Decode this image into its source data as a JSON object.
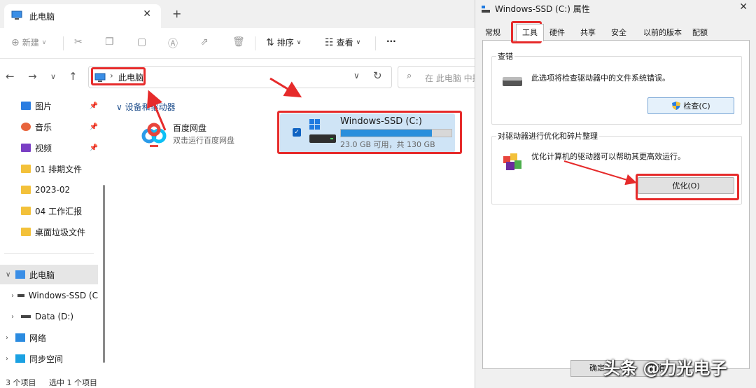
{
  "explorer": {
    "tab_title": "此电脑",
    "tab_close": "✕",
    "new_tab": "+",
    "toolbar": {
      "new_label": "新建",
      "sort_label": "排序",
      "view_label": "查看",
      "more": "···"
    },
    "nav": {
      "back": "←",
      "forward": "→",
      "recent": "∨",
      "up": "↑"
    },
    "address": {
      "crumb": "此电脑",
      "chevron": "›",
      "dropdown": "∨",
      "refresh": "↻"
    },
    "search": {
      "placeholder": "在 此电脑 中搜"
    },
    "sidebar": {
      "pinned": [
        {
          "label": "图片",
          "icon": "picture-icon"
        },
        {
          "label": "音乐",
          "icon": "music-icon"
        },
        {
          "label": "视频",
          "icon": "video-icon"
        },
        {
          "label": "01 排期文件",
          "icon": "folder-icon"
        },
        {
          "label": "2023-02",
          "icon": "folder-icon"
        },
        {
          "label": "04 工作汇报",
          "icon": "folder-icon"
        },
        {
          "label": "桌面垃圾文件",
          "icon": "folder-icon"
        }
      ],
      "tree": [
        {
          "label": "此电脑",
          "icon": "pc-icon",
          "expanded": true,
          "selected": true
        },
        {
          "label": "Windows-SSD (C",
          "icon": "drive-icon"
        },
        {
          "label": "Data (D:)",
          "icon": "drive-icon"
        },
        {
          "label": "网络",
          "icon": "network-icon"
        },
        {
          "label": "同步空间",
          "icon": "sync-icon"
        }
      ]
    },
    "content": {
      "group_header": "设备和驱动器",
      "group_chevron": "∨",
      "baidu": {
        "name": "百度网盘",
        "subtitle": "双击运行百度网盘"
      },
      "drive": {
        "name": "Windows-SSD (C:)",
        "free_text": "23.0 GB 可用，共 130 GB",
        "used_fraction": 0.823
      }
    },
    "status": {
      "count": "3 个项目",
      "selected": "选中 1 个项目"
    }
  },
  "dialog": {
    "title": "Windows-SSD (C:) 属性",
    "close": "✕",
    "tabs": [
      "常规",
      "工具",
      "硬件",
      "共享",
      "安全",
      "以前的版本",
      "配额"
    ],
    "active_tab": "工具",
    "error_check": {
      "title": "查错",
      "desc": "此选项将检查驱动器中的文件系统错误。",
      "button": "检查(C)"
    },
    "optimize": {
      "title": "对驱动器进行优化和碎片整理",
      "desc": "优化计算机的驱动器可以帮助其更高效运行。",
      "button": "优化(O)"
    },
    "ok_button": "确定",
    "cancel_button": "取消"
  },
  "watermark": "头条 @力光电子",
  "colors": {
    "annotation": "#e62b2b",
    "accent": "#0f62c2",
    "drive_fill": "#2a8fdc"
  }
}
